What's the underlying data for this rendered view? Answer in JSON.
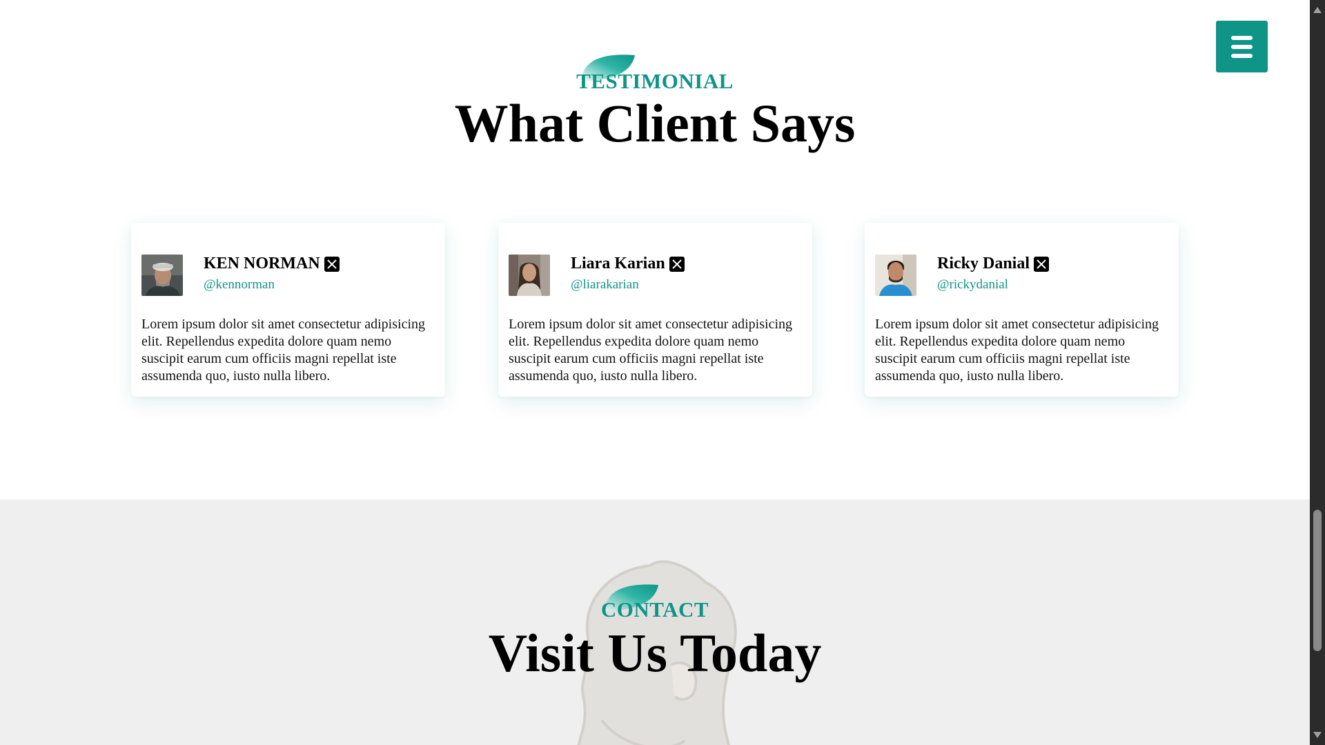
{
  "testimonial": {
    "eyebrow": "TESTIMONIAL",
    "title": "What Client Says",
    "cards": [
      {
        "name": "KEN NORMAN",
        "handle": "@kennorman",
        "icon": "x-logo-icon",
        "quote": "Lorem ipsum dolor sit amet consectetur adipisicing elit. Repellendus expedita dolore quam nemo suscipit earum cum officiis magni repellat iste assumenda quo, iusto nulla libero."
      },
      {
        "name": "Liara Karian",
        "handle": "@liarakarian",
        "icon": "x-logo-icon",
        "quote": "Lorem ipsum dolor sit amet consectetur adipisicing elit. Repellendus expedita dolore quam nemo suscipit earum cum officiis magni repellat iste assumenda quo, iusto nulla libero."
      },
      {
        "name": "Ricky Danial",
        "handle": "@rickydanial",
        "icon": "x-logo-icon",
        "quote": "Lorem ipsum dolor sit amet consectetur adipisicing elit. Repellendus expedita dolore quam nemo suscipit earum cum officiis magni repellat iste assumenda quo, iusto nulla libero."
      }
    ]
  },
  "contact": {
    "eyebrow": "CONTACT",
    "title": "Visit Us Today"
  },
  "menu": {
    "icon": "hamburger-menu-icon"
  },
  "colors": {
    "accent": "#0f9488",
    "contact_bg": "#efefef",
    "scrollbar_bg": "#2b2b2b"
  }
}
